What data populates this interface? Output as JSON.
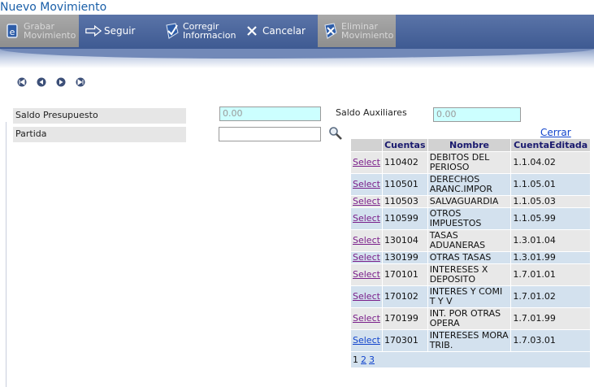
{
  "page_title": "Nuevo Movimiento",
  "toolbar": {
    "grabar": "Grabar\nMovimiento",
    "seguir": "Seguir",
    "corregir": "Corregir\nInformacion",
    "cancelar": "Cancelar",
    "eliminar": "Eliminar\nMovimiento"
  },
  "form": {
    "saldo_presupuesto_label": "Saldo Presupuesto",
    "saldo_presupuesto_value": "0.00",
    "saldo_auxiliares_label": "Saldo Auxiliares",
    "saldo_auxiliares_value": "0.00",
    "partida_label": "Partida",
    "partida_value": ""
  },
  "lookup": {
    "close_label": "Cerrar",
    "columns": [
      "",
      "Cuentas",
      "Nombre",
      "CuentaEditada"
    ],
    "rows": [
      {
        "select": "Select",
        "cuenta": "110402",
        "nombre": "DEBITOS DEL PERIOSO",
        "editada": "1.1.04.02"
      },
      {
        "select": "Select",
        "cuenta": "110501",
        "nombre": "DERECHOS ARANC.IMPOR",
        "editada": "1.1.05.01"
      },
      {
        "select": "Select",
        "cuenta": "110503",
        "nombre": "SALVAGUARDIA",
        "editada": "1.1.05.03"
      },
      {
        "select": "Select",
        "cuenta": "110599",
        "nombre": "OTROS IMPUESTOS",
        "editada": "1.1.05.99"
      },
      {
        "select": "Select",
        "cuenta": "130104",
        "nombre": "TASAS ADUANERAS",
        "editada": "1.3.01.04"
      },
      {
        "select": "Select",
        "cuenta": "130199",
        "nombre": "OTRAS TASAS",
        "editada": "1.3.01.99"
      },
      {
        "select": "Select",
        "cuenta": "170101",
        "nombre": "INTERESES X DEPOSITO",
        "editada": "1.7.01.01"
      },
      {
        "select": "Select",
        "cuenta": "170102",
        "nombre": "INTERES Y COMI T Y V",
        "editada": "1.7.01.02"
      },
      {
        "select": "Select",
        "cuenta": "170199",
        "nombre": "INT. POR OTRAS OPERA",
        "editada": "1.7.01.99"
      },
      {
        "select": "Select",
        "cuenta": "170301",
        "nombre": "INTERESES MORA TRIB.",
        "editada": "1.7.03.01"
      }
    ],
    "pager": {
      "current": "1",
      "pages": [
        "2",
        "3"
      ]
    }
  },
  "icons": {
    "grabar": "save-icon",
    "seguir": "arrow-right-icon",
    "corregir": "check-icon",
    "cancelar": "x-icon",
    "eliminar": "delete-icon",
    "first": "first-page-icon",
    "prev": "prev-page-icon",
    "next": "next-page-icon",
    "last": "last-page-icon",
    "search": "search-icon"
  },
  "colors": {
    "title": "#1a5fa8",
    "toolbar": "#4a6498",
    "cyan_input": "#ccffff",
    "row_odd": "#e8e8e8",
    "row_even": "#d3e1ee",
    "link": "#1144cc",
    "visited_link": "#7a1f8a"
  }
}
